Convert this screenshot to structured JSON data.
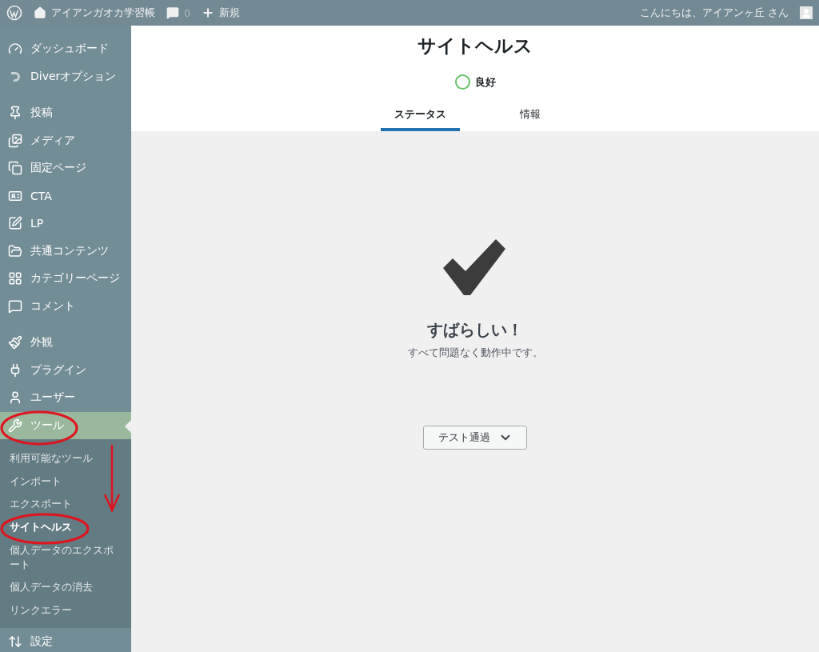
{
  "admin_bar": {
    "site_name": "アイアンガオカ学習帳",
    "comments_count": "0",
    "new_label": "新規",
    "greeting": "こんにちは、アイアンヶ丘 さん"
  },
  "sidebar": {
    "sections": [
      [
        {
          "label": "ダッシュボード",
          "selected": false
        },
        {
          "label": "Diverオプション",
          "selected": false
        }
      ],
      [
        {
          "label": "投稿",
          "selected": false
        },
        {
          "label": "メディア",
          "selected": false
        },
        {
          "label": "固定ページ",
          "selected": false
        },
        {
          "label": "CTA",
          "selected": false
        },
        {
          "label": "LP",
          "selected": false
        },
        {
          "label": "共通コンテンツ",
          "selected": false
        },
        {
          "label": "カテゴリーページ",
          "selected": false
        },
        {
          "label": "コメント",
          "selected": false
        }
      ],
      [
        {
          "label": "外観",
          "selected": false
        },
        {
          "label": "プラグイン",
          "selected": false
        },
        {
          "label": "ユーザー",
          "selected": false
        },
        {
          "label": "ツール",
          "selected": true,
          "children": [
            {
              "label": "利用可能なツール",
              "selected": false
            },
            {
              "label": "インポート",
              "selected": false
            },
            {
              "label": "エクスポート",
              "selected": false
            },
            {
              "label": "サイトヘルス",
              "selected": true
            },
            {
              "label": "個人データのエクスポート",
              "selected": false
            },
            {
              "label": "個人データの消去",
              "selected": false
            },
            {
              "label": "リンクエラー",
              "selected": false
            }
          ]
        },
        {
          "label": "設定",
          "selected": false
        }
      ]
    ]
  },
  "header": {
    "title": "サイトヘルス",
    "status": "良好",
    "tabs": [
      {
        "label": "ステータス",
        "selected": true
      },
      {
        "label": "情報",
        "selected": false
      }
    ]
  },
  "result": {
    "heading": "すばらしい！",
    "message": "すべて問題なく動作中です。",
    "button": "テスト通過"
  }
}
